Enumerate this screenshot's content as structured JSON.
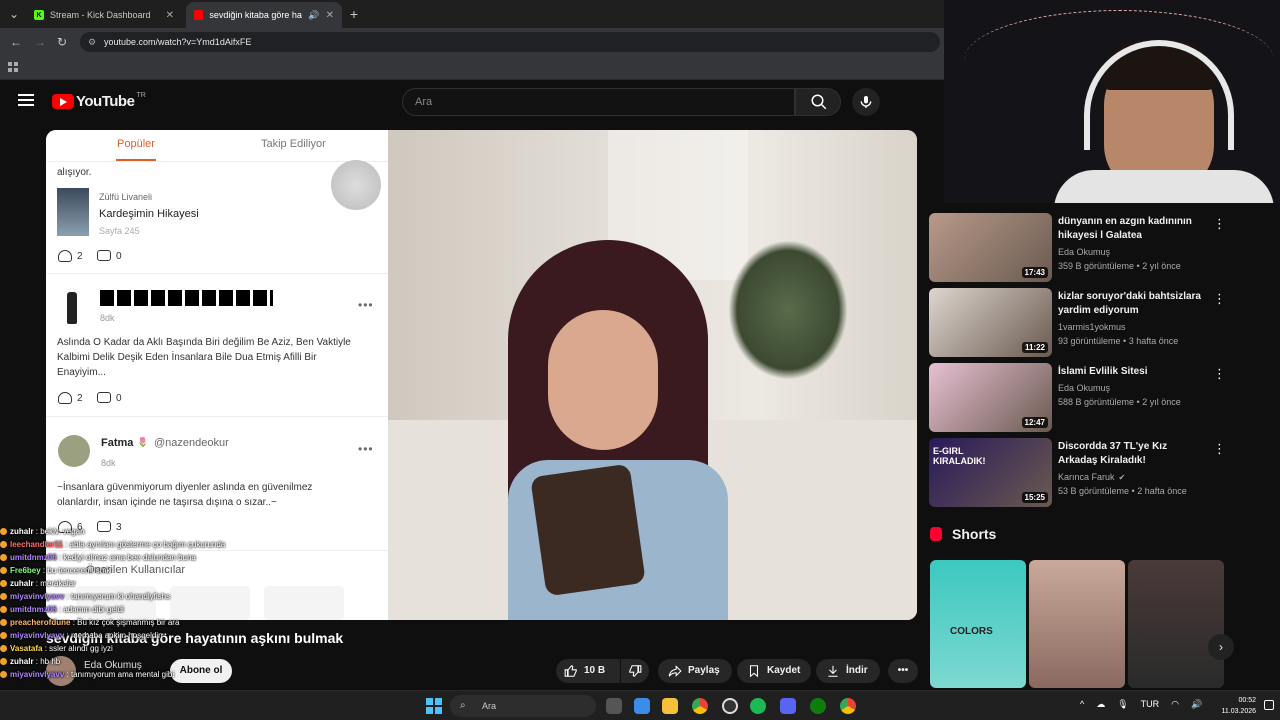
{
  "browser": {
    "tabs": [
      {
        "label": "Stream - Kick Dashboard",
        "favicon_color": "#53fc18",
        "active": false
      },
      {
        "label": "sevdiğin kitaba göre hayatın",
        "favicon_color": "#ff0000",
        "active": true
      }
    ],
    "url": "youtube.com/watch?v=Ymd1dAifxFE"
  },
  "youtube": {
    "logo_text": "YouTube",
    "country_code": "TR",
    "search_placeholder": "Ara"
  },
  "phone_app": {
    "tabs": [
      "Popüler",
      "Takip Ediliyor"
    ],
    "snippet": "alışıyor.",
    "posts": [
      {
        "author": "Zülfü Livaneli",
        "title": "Kardeşimin Hikayesi",
        "page": "Sayfa 245",
        "likes": "2",
        "comments": "0"
      },
      {
        "time": "8dk",
        "text": "Aslında O Kadar da Aklı Başında Biri değilim Be Aziz, Ben Vaktiyle Kalbimi Delik Deşik Eden İnsanlara Bile Dua Etmiş Afilli Bir Enayiyim...",
        "likes": "2",
        "comments": "0"
      },
      {
        "name": "Fatma",
        "handle": "@nazendeokur",
        "time": "8dk",
        "text": "~İnsanlara güvenmiyorum diyenler aslında en güvenilmez olanlardır, insan içinde ne taşırsa dışına o sızar..~",
        "likes": "6",
        "comments": "3"
      }
    ],
    "suggested": "Önerilen Kullanıcılar"
  },
  "video": {
    "title": "sevdiğin kitaba göre hayatının aşkını bulmak",
    "channel": "Eda Okumuş",
    "subscribe": "Abone ol",
    "likes": "10 B",
    "share": "Paylaş",
    "save": "Kaydet",
    "download": "İndir"
  },
  "chat": [
    {
      "user": "zuhalr",
      "msg": "beklv. vegan",
      "color": "#ffffff"
    },
    {
      "user": "leechandler11",
      "msg": "abla aynılanı gösterme ço bağım çukurunda",
      "color": "#ff6b6b"
    },
    {
      "user": "umitdnmz06",
      "msg": "kediyi olmaz ama bee dalundan buna",
      "color": "#b084ff"
    },
    {
      "user": "Fre6bey",
      "msg": "bu tencereml smk",
      "color": "#7dff7d"
    },
    {
      "user": "zuhalr",
      "msg": "merakalar",
      "color": "#ffffff"
    },
    {
      "user": "miyavinvlyavv",
      "msg": "tanımıyorum ki ohandlyfishs",
      "color": "#b084ff"
    },
    {
      "user": "umitdnmz06",
      "msg": "adamın dibi geldi",
      "color": "#b084ff"
    },
    {
      "user": "preacherofdune",
      "msg": "Bu kız çok şişmanmış bir ara",
      "color": "#ffb86b"
    },
    {
      "user": "miyavinvlyavv",
      "msg": "merhaba ankim hoşgeldin",
      "color": "#b084ff"
    },
    {
      "user": "Vasatafa",
      "msg": "ssler alındı gg iyzi",
      "color": "#ffd84d"
    },
    {
      "user": "zuhalr",
      "msg": "hb hb",
      "color": "#ffffff"
    },
    {
      "user": "miyavinvlyavv",
      "msg": "tanımıyorum ama mental gibi",
      "color": "#b084ff"
    }
  ],
  "recommendations": [
    {
      "title": "dünyanın en azgın kadınının hikayesi l Galatea",
      "channel": "Eda Okumuş",
      "meta": "359 B görüntüleme • 2 yıl önce",
      "duration": "17:43",
      "verified": false,
      "thumb_color": "#b89a8a"
    },
    {
      "title": "kizlar soruyor'daki bahtsizlara yardim ediyorum",
      "channel": "1varmis1yokmus",
      "meta": "93 görüntüleme • 3 hafta önce",
      "duration": "11:22",
      "verified": false,
      "thumb_color": "#ddd6cf"
    },
    {
      "title": "İslami Evlilik Sitesi",
      "channel": "Eda Okumuş",
      "meta": "588 B görüntüleme • 2 yıl önce",
      "duration": "12:47",
      "verified": false,
      "thumb_color": "#e7c0d2"
    },
    {
      "title": "Discordda 37 TL'ye Kız Arkadaş Kiraladık!",
      "channel": "Karınca Faruk",
      "meta": "53 B görüntüleme • 2 hafta önce",
      "duration": "15:25",
      "verified": true,
      "thumb_color": "#2a1a5a",
      "thumb_text": "E-GIRL KIRALADIK!"
    }
  ],
  "shorts": {
    "label": "Shorts",
    "items": [
      {
        "color": "#3cc8c0",
        "text": "COLORS"
      },
      {
        "color": "#c9a99a",
        "text": ""
      },
      {
        "color": "#3a3a3a",
        "text": ""
      }
    ]
  },
  "taskbar": {
    "search": "Ara",
    "lang": "TUR",
    "time": "00:52",
    "date": "11.03.2026"
  }
}
